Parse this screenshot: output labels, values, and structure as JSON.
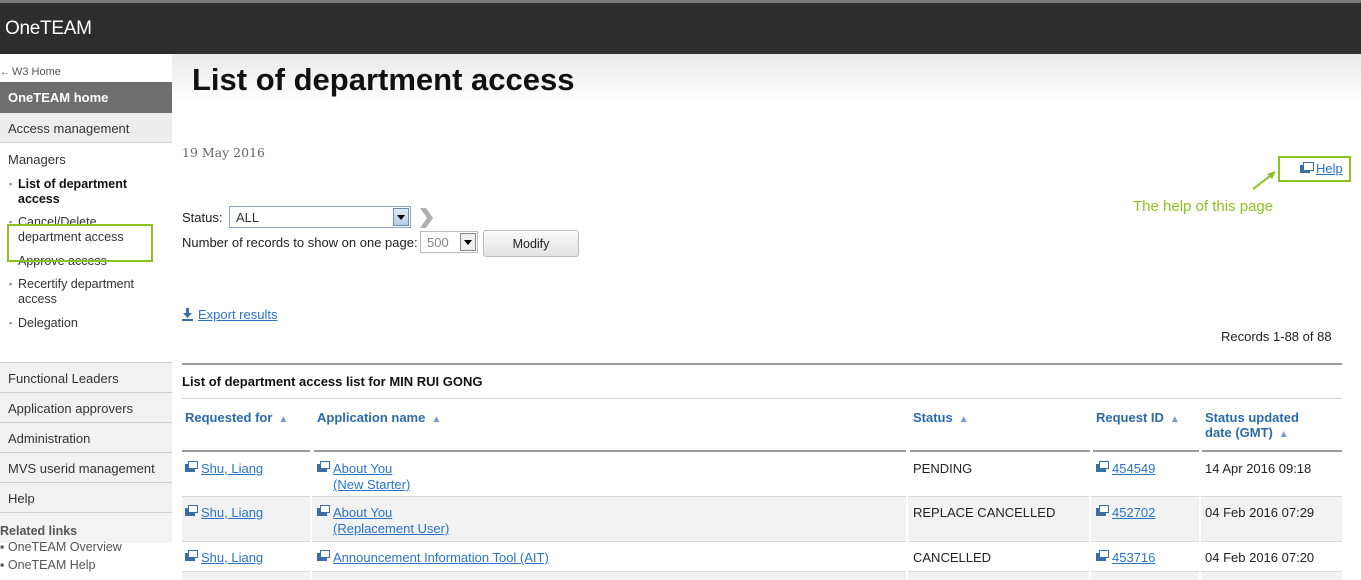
{
  "app": {
    "title": "OneTEAM"
  },
  "sidebar": {
    "w3home": "W3 Home",
    "home": "OneTEAM home",
    "access_management": "Access management",
    "managers": "Managers",
    "manager_items": [
      {
        "label": "List of department access"
      },
      {
        "label": "Cancel/Delete department access"
      },
      {
        "label": "Approve access"
      },
      {
        "label": "Recertify department access"
      },
      {
        "label": "Delegation"
      }
    ],
    "sections": [
      "Functional Leaders",
      "Application approvers",
      "Administration",
      "MVS userid management",
      "Help"
    ],
    "related_title": "Related links",
    "related_links": [
      "OneTEAM Overview",
      "OneTEAM Help"
    ]
  },
  "page": {
    "title": "List of department access",
    "date": "19 May 2016",
    "help": "Help",
    "annotation": "The help of this page"
  },
  "filters": {
    "status_label": "Status:",
    "status_value": "ALL",
    "records_label": "Number of records to show on one page:",
    "records_value": "500",
    "modify_label": "Modify"
  },
  "export_label": "Export results",
  "records_summary": "Records 1-88 of 88",
  "table": {
    "caption": "List of department access list for MIN RUI GONG",
    "headers": {
      "requested_for": "Requested for",
      "application": "Application name",
      "status": "Status",
      "request_id": "Request ID",
      "updated_line1": "Status updated",
      "updated_line2": "date (GMT)"
    },
    "rows": [
      {
        "requested_for": "Shu, Liang",
        "app_line1": "About You",
        "app_line2": "(New Starter)",
        "status": "PENDING",
        "request_id": "454549",
        "updated": "14 Apr 2016 09:18"
      },
      {
        "requested_for": "Shu, Liang",
        "app_line1": "About You",
        "app_line2": "(Replacement User)",
        "status": "REPLACE CANCELLED",
        "request_id": "452702",
        "updated": "04 Feb 2016 07:29"
      },
      {
        "requested_for": "Shu, Liang",
        "app_line1": "Announcement Information Tool (AIT)",
        "app_line2": "",
        "status": "CANCELLED",
        "request_id": "453716",
        "updated": "04 Feb 2016 07:20"
      }
    ]
  },
  "colors": {
    "accent_green": "#8cc21f",
    "link_blue": "#2a73c8",
    "header_dark": "#2d2d2d"
  }
}
